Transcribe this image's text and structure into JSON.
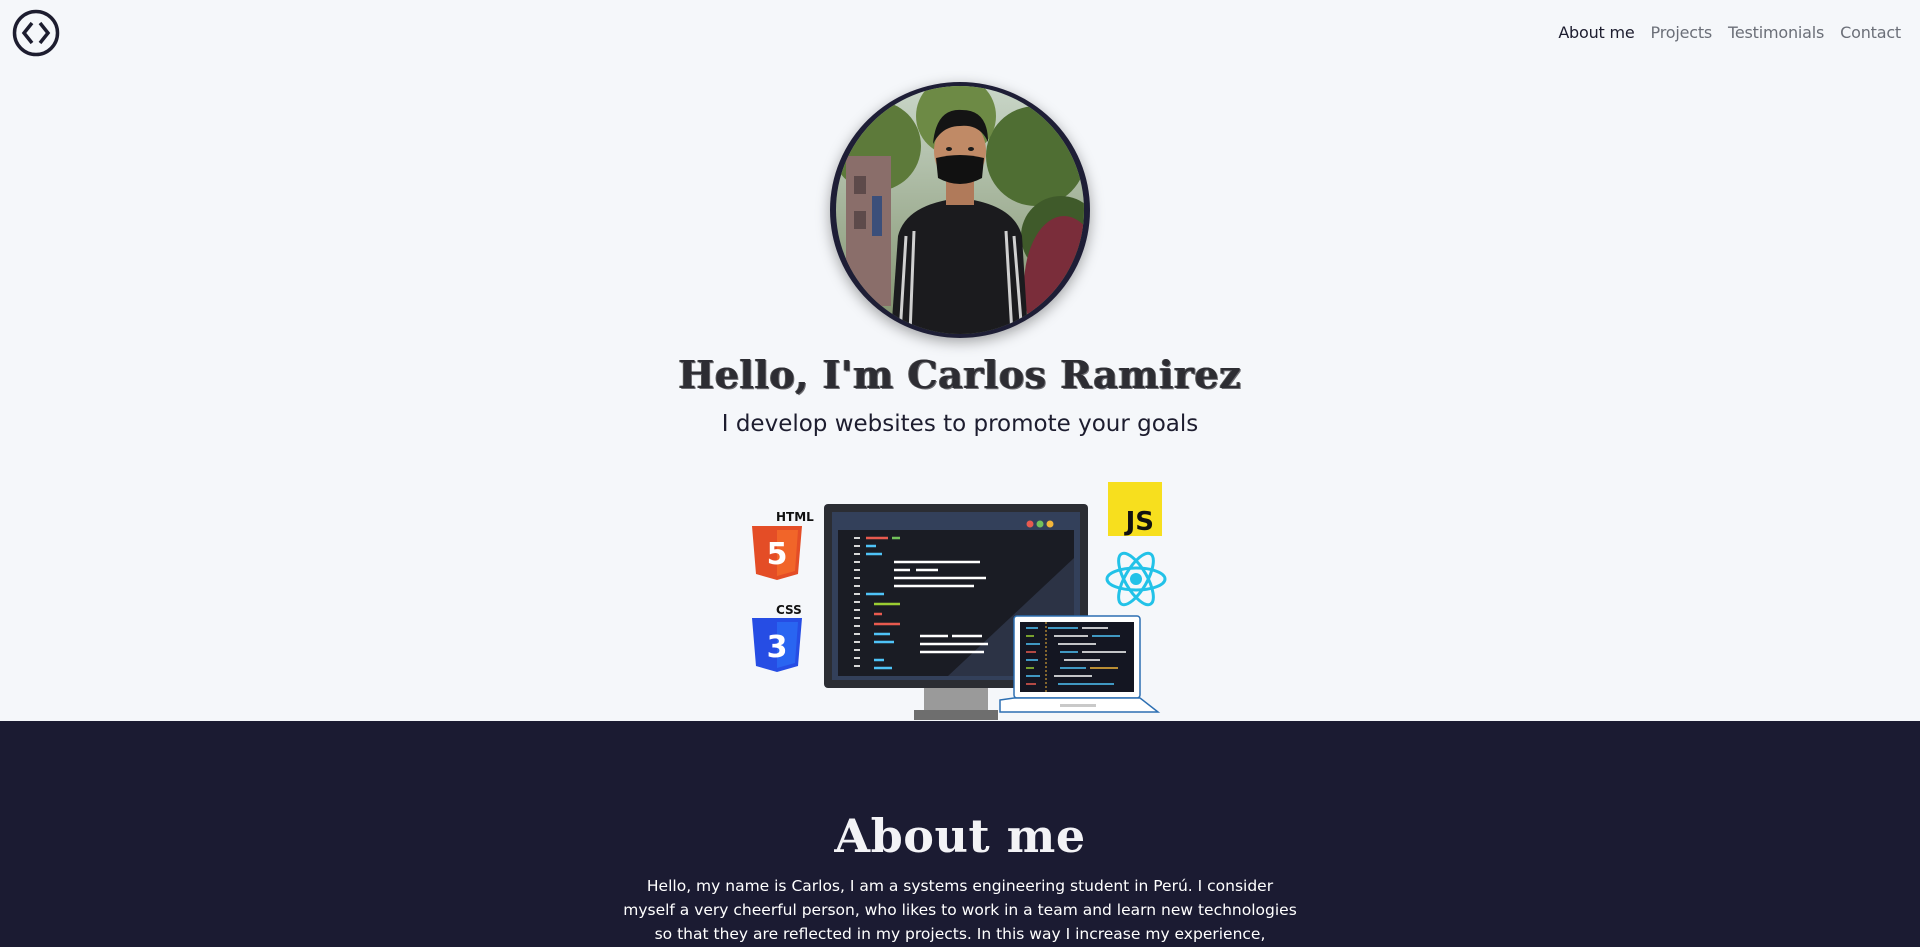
{
  "header": {
    "logo_icon": "code-brackets-icon",
    "nav": [
      {
        "label": "About me",
        "active": true
      },
      {
        "label": "Projects",
        "active": false
      },
      {
        "label": "Testimonials",
        "active": false
      },
      {
        "label": "Contact",
        "active": false
      }
    ]
  },
  "hero": {
    "title": "Hello, I'm Carlos Ramirez",
    "subtitle": "I develop websites to promote your goals",
    "tech_labels": {
      "html": "HTML",
      "css": "CSS",
      "js": "JS"
    }
  },
  "about": {
    "title": "About me",
    "text": "Hello, my name is Carlos, I am a systems engineering student in Perú. I consider myself a very cheerful person, who likes to work in a team and learn new technologies so that they are reflected in my projects. In this way I increase my experience, studying and sharing my learning"
  },
  "colors": {
    "page_bg": "#f5f7fa",
    "dark_bg": "#1b1b32",
    "html_orange": "#e44d26",
    "css_blue": "#264de4",
    "js_yellow": "#f7df1e",
    "react_cyan": "#22c2e8"
  }
}
